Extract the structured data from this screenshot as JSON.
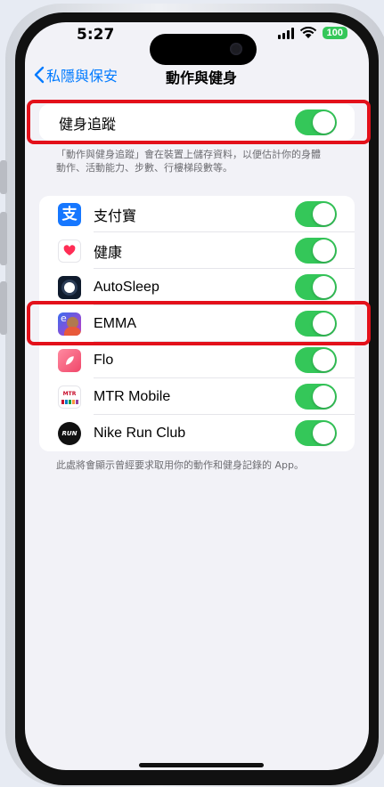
{
  "status_bar": {
    "time": "5:27",
    "battery": "100"
  },
  "nav": {
    "back_label": "私隱與保安",
    "title": "動作與健身"
  },
  "fitness_tracking": {
    "label": "健身追蹤",
    "enabled": true,
    "description_line1": "「動作與健身追蹤」會在裝置上儲存資料，以便估計你的身體",
    "description_line2": "動作、活動能力、步數、行樓梯段數等。"
  },
  "apps": [
    {
      "name": "支付寶",
      "icon": "alipay-icon",
      "enabled": true
    },
    {
      "name": "健康",
      "icon": "health-heart-icon",
      "enabled": true
    },
    {
      "name": "AutoSleep",
      "icon": "autosleep-icon",
      "enabled": true
    },
    {
      "name": "EMMA",
      "icon": "emma-icon",
      "enabled": true,
      "emma_badge": "e"
    },
    {
      "name": "Flo",
      "icon": "flo-icon",
      "enabled": true
    },
    {
      "name": "MTR Mobile",
      "icon": "mtr-icon",
      "enabled": true,
      "mtr_badge": "MTR"
    },
    {
      "name": "Nike Run Club",
      "icon": "nike-run-club-icon",
      "enabled": true,
      "nike_badge": "RUN"
    }
  ],
  "apps_footnote": "此處將會顯示曾經要求取用你的動作和健身記錄的 App。",
  "colors": {
    "accent": "#007aff",
    "toggle_on": "#34c759",
    "highlight": "#e3101a"
  }
}
